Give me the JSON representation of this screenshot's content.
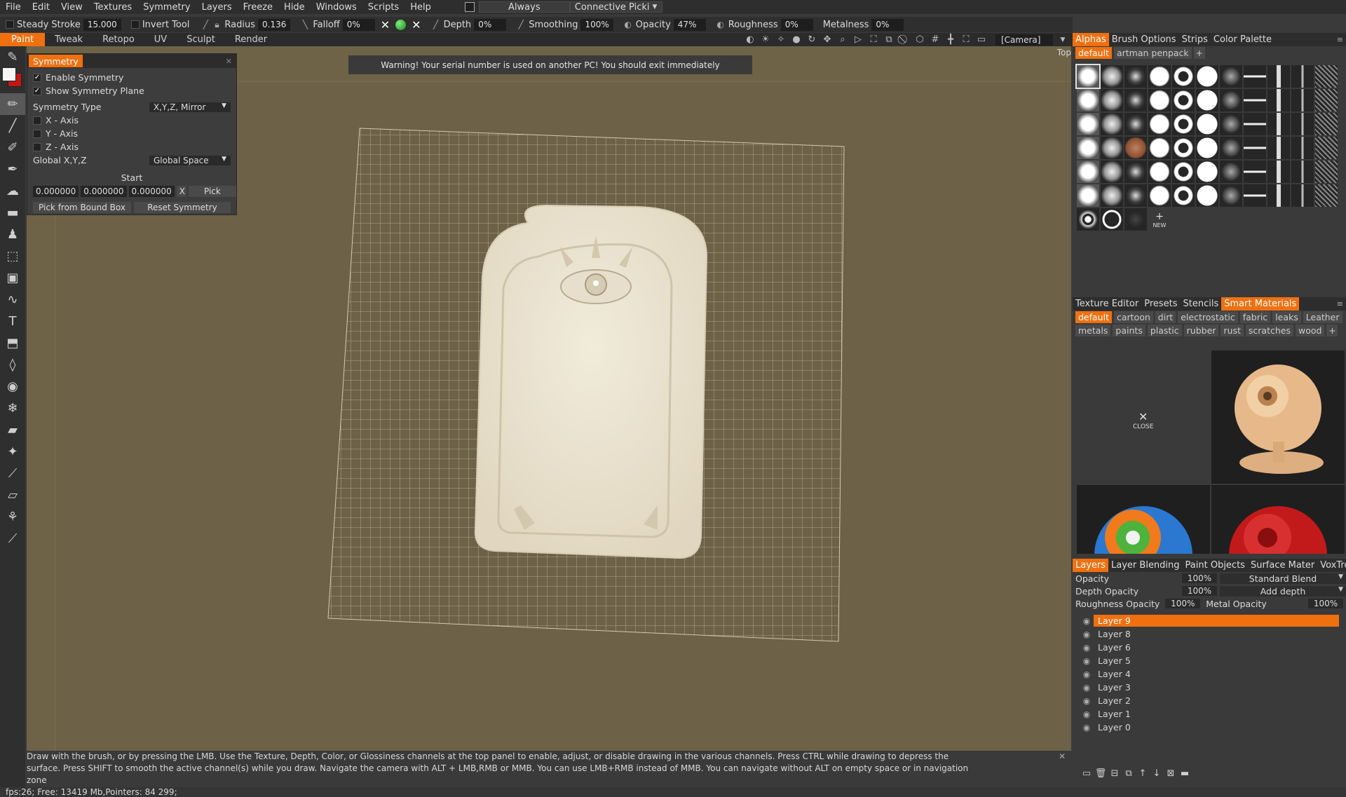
{
  "menu": {
    "items": [
      "File",
      "Edit",
      "View",
      "Textures",
      "Symmetry",
      "Layers",
      "Freeze",
      "Hide",
      "Windows",
      "Scripts",
      "Help"
    ],
    "always_label": "Always",
    "picking_label": "Connective Picki"
  },
  "params": {
    "steady_stroke_label": "Steady Stroke",
    "steady_stroke_value": "15.000",
    "invert_tool_label": "Invert Tool",
    "radius_label": "Radius",
    "radius_value": "0.136",
    "falloff_label": "Falloff",
    "falloff_value": "0%",
    "depth_label": "Depth",
    "depth_value": "0%",
    "smoothing_label": "Smoothing",
    "smoothing_value": "100%",
    "opacity_label": "Opacity",
    "opacity_value": "47%",
    "roughness_label": "Roughness",
    "roughness_value": "0%",
    "metalness_label": "Metalness",
    "metalness_value": "0%"
  },
  "rooms": {
    "tabs": [
      "Paint",
      "Tweak",
      "Retopo",
      "UV",
      "Sculpt",
      "Render"
    ],
    "active": "Paint"
  },
  "view": {
    "camera": "[Camera]",
    "projection": "Top",
    "warning": "Warning! Your serial number is used on another PC! You should exit immediately"
  },
  "symmetry": {
    "title": "Symmetry",
    "enable_label": "Enable Symmetry",
    "show_plane_label": "Show Symmetry Plane",
    "type_label": "Symmetry Type",
    "type_value": "X,Y,Z, Mirror",
    "x_axis": "X - Axis",
    "y_axis": "Y - Axis",
    "z_axis": "Z - Axis",
    "global_label": "Global X,Y,Z",
    "global_value": "Global Space",
    "start_label": "Start",
    "start_x": "0.000000",
    "start_y": "0.000000",
    "start_z": "0.000000",
    "x_button": "X",
    "pick_button": "Pick",
    "pick_bound_button": "Pick from Bound Box",
    "reset_button": "Reset Symmetry"
  },
  "hint": {
    "line1": "Draw with the brush, or by pressing the LMB. Use the Texture, Depth, Color, or Glossiness channels at the top panel to enable, adjust, or disable drawing in the various channels. Press CTRL while drawing to depress the",
    "line2": "surface. Press SHIFT to smooth the active channel(s) while you draw. Navigate the camera with ALT + LMB,RMB or MMB. You can use LMB+RMB instead of MMB. You can navigate without ALT on empty space or in navigation",
    "line3": "zone"
  },
  "status": {
    "text": "fps:26;    Free: 13419 Mb,Pointers: 84 299;"
  },
  "alphas": {
    "tabs": [
      "Alphas",
      "Brush Options",
      "Strips",
      "Color Palette"
    ],
    "active_tab": "Alphas",
    "sets": [
      "default",
      "artman penpack"
    ],
    "new_label": "NEW"
  },
  "smart": {
    "tabs": [
      "Texture Editor",
      "Presets",
      "Stencils",
      "Smart Materials"
    ],
    "active_tab": "Smart Materials",
    "cats_row1": [
      "default",
      "cartoon",
      "dirt",
      "electrostatic",
      "fabric",
      "leaks",
      "Leather"
    ],
    "cats_row2": [
      "metals",
      "paints",
      "plastic",
      "rubber",
      "rust",
      "scratches",
      "wood"
    ],
    "close_label": "CLOSE"
  },
  "layers": {
    "tabs": [
      "Layers",
      "Layer Blending",
      "Paint Objects",
      "Surface Mater",
      "VoxTree"
    ],
    "active_tab": "Layers",
    "opacity_label": "Opacity",
    "opacity_value": "100%",
    "blend_value": "Standard Blend",
    "depth_opacity_label": "Depth Opacity",
    "depth_opacity_value": "100%",
    "depth_mode_value": "Add depth",
    "rough_opacity_label": "Roughness Opacity",
    "rough_opacity_value": "100%",
    "metal_opacity_label": "Metal Opacity",
    "metal_opacity_value": "100%",
    "list": [
      "Layer 9",
      "Layer 8",
      "Layer 6",
      "Layer 5",
      "Layer 4",
      "Layer 3",
      "Layer 2",
      "Layer 1",
      "Layer 0"
    ],
    "selected": "Layer 9"
  },
  "colors": {
    "accent": "#f07010",
    "primary_color": "#f5f5f5",
    "secondary_color": "#c41515",
    "viewport_bg": "#6e6346"
  }
}
